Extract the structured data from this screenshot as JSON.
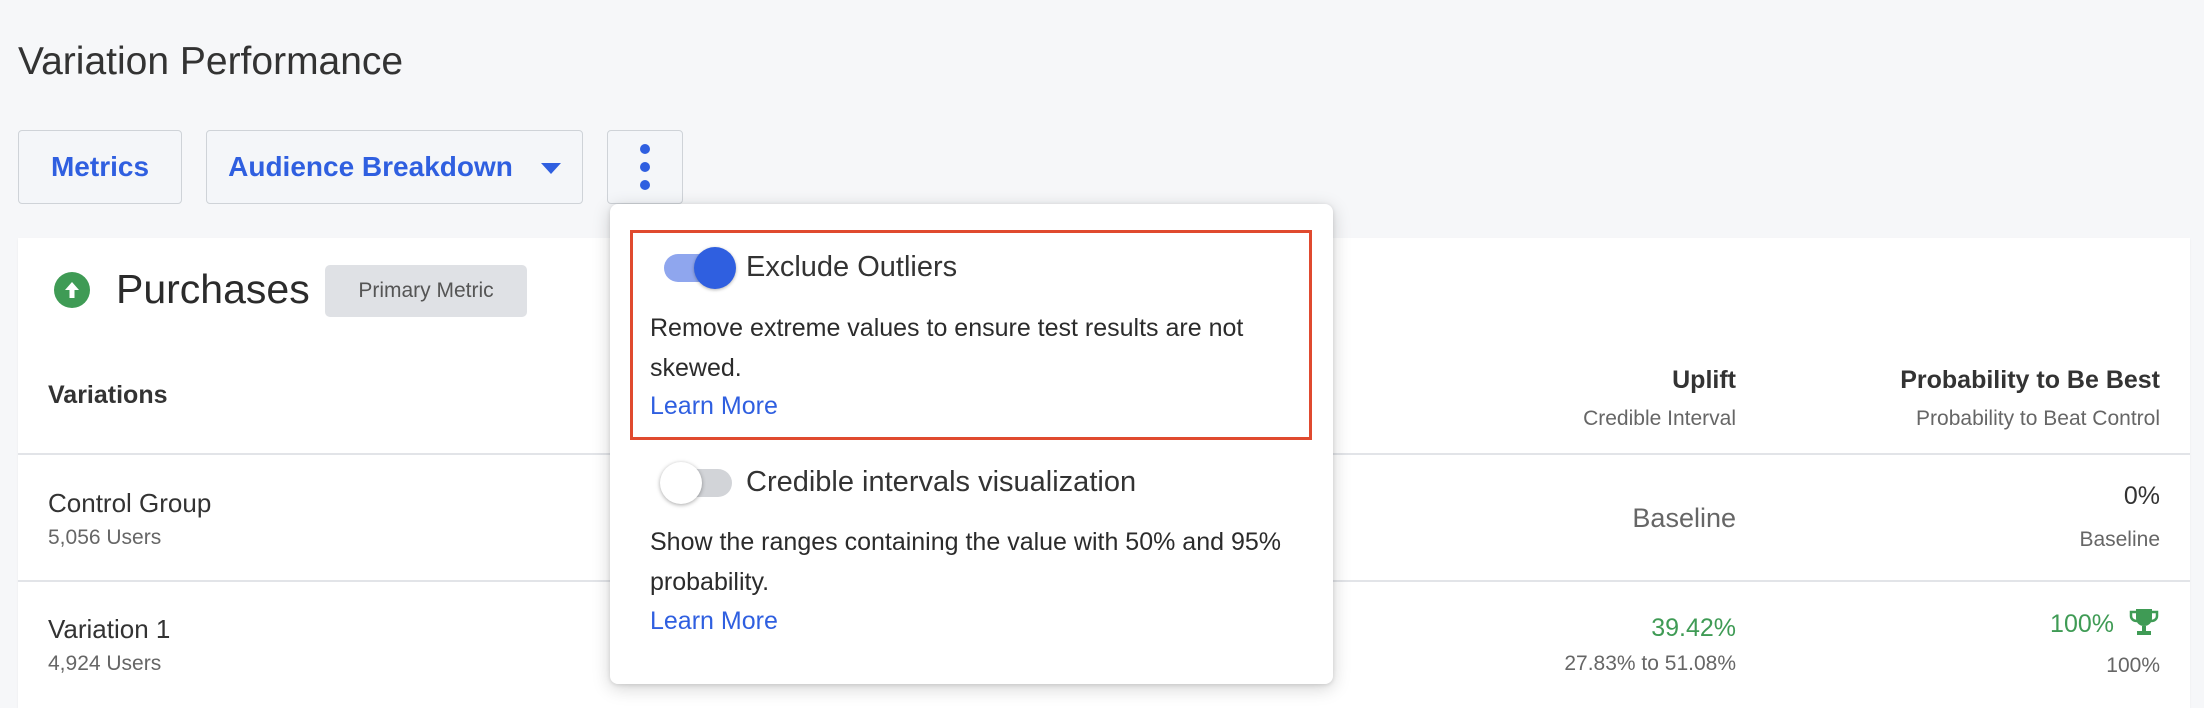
{
  "page": {
    "title": "Variation Performance"
  },
  "toolbar": {
    "metrics_label": "Metrics",
    "audience_label": "Audience Breakdown",
    "more_icon": "vertical-ellipsis-icon"
  },
  "metric": {
    "title": "Purchases",
    "badge": "Primary Metric",
    "icon": "arrow-up-circle-icon",
    "icon_color": "#3f9b55"
  },
  "table": {
    "headers": {
      "variations": "Variations",
      "uplift": "Uplift",
      "uplift_sub": "Credible Interval",
      "probability": "Probability to Be Best",
      "probability_sub": "Probability to Beat Control"
    },
    "rows": [
      {
        "name": "Control Group",
        "users": "5,056 Users",
        "uplift": "Baseline",
        "uplift_sub": "",
        "probability": "0%",
        "probability_sub": "Baseline"
      },
      {
        "name": "Variation 1",
        "users": "4,924 Users",
        "uplift": "39.42%",
        "uplift_sub": "27.83% to 51.08%",
        "probability": "100%",
        "probability_sub": "100%",
        "winner_icon": "trophy-icon"
      }
    ]
  },
  "popover": {
    "options": [
      {
        "title": "Exclude Outliers",
        "enabled": true,
        "description": "Remove extreme values to ensure test results are not skewed.",
        "link": "Learn More"
      },
      {
        "title": "Credible intervals visualization",
        "enabled": false,
        "description": "Show the ranges containing the value with 50% and 95% probability.",
        "link": "Learn More"
      }
    ]
  },
  "colors": {
    "accent": "#2f5fe0",
    "positive": "#3f9b55",
    "highlight": "#e04a2f"
  }
}
